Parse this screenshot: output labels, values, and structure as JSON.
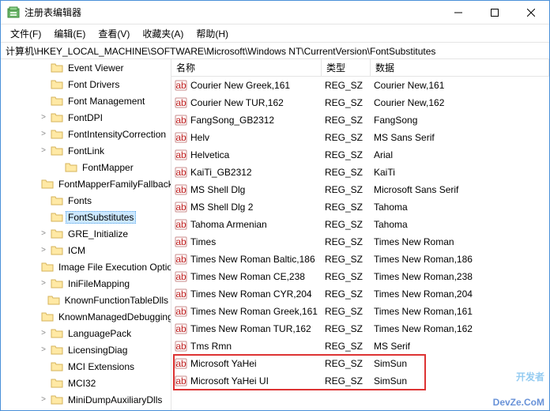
{
  "window": {
    "title": "注册表编辑器"
  },
  "menu": {
    "file": "文件(F)",
    "edit": "编辑(E)",
    "view": "查看(V)",
    "favorites": "收藏夹(A)",
    "help": "帮助(H)"
  },
  "address_path": "计算机\\HKEY_LOCAL_MACHINE\\SOFTWARE\\Microsoft\\Windows NT\\CurrentVersion\\FontSubstitutes",
  "columns": {
    "name": "名称",
    "type": "类型",
    "data": "数据"
  },
  "tree": [
    {
      "label": "Event Viewer",
      "indent": 0,
      "expander": ""
    },
    {
      "label": "Font Drivers",
      "indent": 0,
      "expander": ""
    },
    {
      "label": "Font Management",
      "indent": 0,
      "expander": ""
    },
    {
      "label": "FontDPI",
      "indent": 0,
      "expander": ">"
    },
    {
      "label": "FontIntensityCorrection",
      "indent": 0,
      "expander": ">"
    },
    {
      "label": "FontLink",
      "indent": 0,
      "expander": ">"
    },
    {
      "label": "FontMapper",
      "indent": 1,
      "expander": ""
    },
    {
      "label": "FontMapperFamilyFallback",
      "indent": 0,
      "expander": ""
    },
    {
      "label": "Fonts",
      "indent": 0,
      "expander": ""
    },
    {
      "label": "FontSubstitutes",
      "indent": 0,
      "expander": "",
      "selected": true
    },
    {
      "label": "GRE_Initialize",
      "indent": 0,
      "expander": ">"
    },
    {
      "label": "ICM",
      "indent": 0,
      "expander": ">"
    },
    {
      "label": "Image File Execution Options",
      "indent": 0,
      "expander": ""
    },
    {
      "label": "IniFileMapping",
      "indent": 0,
      "expander": ">"
    },
    {
      "label": "KnownFunctionTableDlls",
      "indent": 0,
      "expander": ""
    },
    {
      "label": "KnownManagedDebuggingDlls",
      "indent": 0,
      "expander": ""
    },
    {
      "label": "LanguagePack",
      "indent": 0,
      "expander": ">"
    },
    {
      "label": "LicensingDiag",
      "indent": 0,
      "expander": ">"
    },
    {
      "label": "MCI Extensions",
      "indent": 0,
      "expander": ""
    },
    {
      "label": "MCI32",
      "indent": 0,
      "expander": ""
    },
    {
      "label": "MiniDumpAuxiliaryDlls",
      "indent": 0,
      "expander": ">"
    }
  ],
  "values": [
    {
      "name": "Courier New Greek,161",
      "type": "REG_SZ",
      "data": "Courier New,161"
    },
    {
      "name": "Courier New TUR,162",
      "type": "REG_SZ",
      "data": "Courier New,162"
    },
    {
      "name": "FangSong_GB2312",
      "type": "REG_SZ",
      "data": "FangSong"
    },
    {
      "name": "Helv",
      "type": "REG_SZ",
      "data": "MS Sans Serif"
    },
    {
      "name": "Helvetica",
      "type": "REG_SZ",
      "data": "Arial"
    },
    {
      "name": "KaiTi_GB2312",
      "type": "REG_SZ",
      "data": "KaiTi"
    },
    {
      "name": "MS Shell Dlg",
      "type": "REG_SZ",
      "data": "Microsoft Sans Serif"
    },
    {
      "name": "MS Shell Dlg 2",
      "type": "REG_SZ",
      "data": "Tahoma"
    },
    {
      "name": "Tahoma Armenian",
      "type": "REG_SZ",
      "data": "Tahoma"
    },
    {
      "name": "Times",
      "type": "REG_SZ",
      "data": "Times New Roman"
    },
    {
      "name": "Times New Roman Baltic,186",
      "type": "REG_SZ",
      "data": "Times New Roman,186"
    },
    {
      "name": "Times New Roman CE,238",
      "type": "REG_SZ",
      "data": "Times New Roman,238"
    },
    {
      "name": "Times New Roman CYR,204",
      "type": "REG_SZ",
      "data": "Times New Roman,204"
    },
    {
      "name": "Times New Roman Greek,161",
      "type": "REG_SZ",
      "data": "Times New Roman,161"
    },
    {
      "name": "Times New Roman TUR,162",
      "type": "REG_SZ",
      "data": "Times New Roman,162"
    },
    {
      "name": "Tms Rmn",
      "type": "REG_SZ",
      "data": "MS Serif"
    },
    {
      "name": "Microsoft YaHei",
      "type": "REG_SZ",
      "data": "SimSun",
      "hl": true
    },
    {
      "name": "Microsoft YaHei UI",
      "type": "REG_SZ",
      "data": "SimSun",
      "hl": true
    }
  ],
  "watermark": {
    "line1": "开发者",
    "line2": "DevZe.CoM"
  }
}
